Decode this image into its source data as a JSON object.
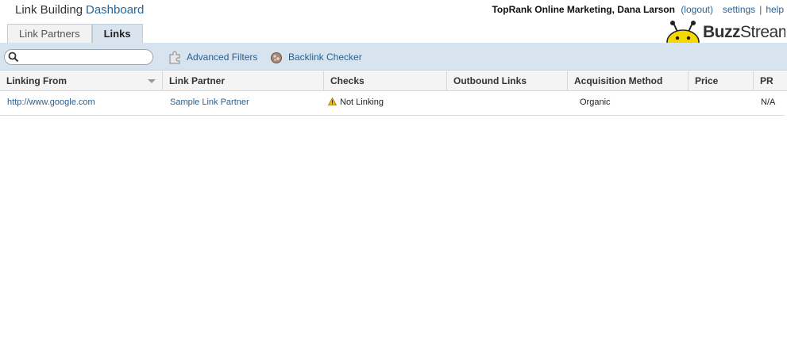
{
  "header": {
    "title": "Link Building",
    "dashboard_link": "Dashboard",
    "user": "TopRank Online Marketing, Dana Larson",
    "logout": "(logout)",
    "settings": "settings",
    "separator": "|",
    "help": "help"
  },
  "logo": {
    "part1": "Buzz",
    "part2": "Stream",
    "icon": "bee-icon"
  },
  "tabs": [
    {
      "label": "Link Partners",
      "active": false
    },
    {
      "label": "Links",
      "active": true
    }
  ],
  "toolbar": {
    "search_value": "",
    "search_placeholder": "",
    "advanced_filters": "Advanced Filters",
    "backlink_checker": "Backlink Checker"
  },
  "table": {
    "columns": [
      "Linking From",
      "Link Partner",
      "Checks",
      "Outbound Links",
      "Acquisition Method",
      "Price",
      "PR"
    ],
    "rows": [
      {
        "linking_from": "http://www.google.com",
        "link_partner": "Sample Link Partner",
        "checks": "Not Linking",
        "outbound_links": "",
        "acquisition_method": "Organic",
        "price": "",
        "pr": "N/A"
      }
    ]
  },
  "colors": {
    "accent": "#2a5f8f",
    "toolbar_bg": "#d7e3ee",
    "warning": "#e8b400"
  }
}
